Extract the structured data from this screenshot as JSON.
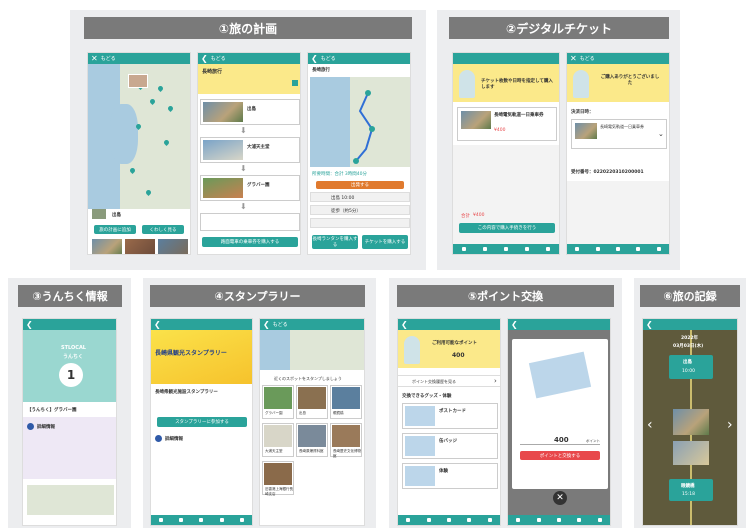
{
  "sections": {
    "s1": "①旅の計画",
    "s2": "②デジタルチケット",
    "s3": "③うんちく情報",
    "s4": "④スタンプラリー",
    "s5": "⑤ポイント交換",
    "s6": "⑥旅の記録"
  },
  "common": {
    "back_label": "もどる",
    "trip_title": "長崎旅行"
  },
  "plan": {
    "map_spot_name": "出島",
    "map_btn_add": "旅の計画に追加",
    "map_btn_detail": "くわしく見る",
    "list_spot1": "出島",
    "list_spot2": "大浦天主堂",
    "list_spot3": "グラバー園",
    "list_btn": "路面電車の乗車券を購入する",
    "route_time": "所要時間：合計 3時間40分",
    "route_btn": "出発する",
    "route_row1": "出島 10:00",
    "route_row2": "徒歩（約5分）",
    "route_btn_left": "長崎ランタンを購入する",
    "route_btn_right": "チケットを購入する"
  },
  "ticket": {
    "banner_left": "チケット枚数や日時を指定して購入します",
    "banner_right": "ご購入ありがとうございました",
    "ticket_name": "長崎電気軌道一日乗車券",
    "price": "¥400",
    "price_label": "合計",
    "buy_btn": "この内容で購入手続きを行う",
    "ticket_number_label": "決済日時：",
    "ticket_number": "受付番号：0220220310200001"
  },
  "trivia": {
    "app_brand": "STLOCAL",
    "title": "うんちく",
    "number": "1",
    "item_title": "【うんちく】グラバー園",
    "section_label": "詳細情報"
  },
  "stamp": {
    "banner_title": "長崎県観光スタンプラリー",
    "event_name": "長崎県観光施設スタンプラリー",
    "join_btn": "スタンプラリーに参加する",
    "section_label": "詳細情報",
    "list_header": "近くのスポットをスタンプしましょう",
    "spots": [
      "グラバー園",
      "出島",
      "眼鏡橋",
      "大浦天主堂",
      "長崎原爆資料館",
      "長崎歴史文化博物館",
      "旧香港上海銀行長崎支店"
    ]
  },
  "points": {
    "available_label": "ご利用可能なポイント",
    "available_value": "400",
    "exchange_label": "ポイント交換履歴を見る",
    "goods_label": "交換できるグッズ・体験",
    "card_number": "400",
    "card_unit": "ポイント",
    "card_btn": "ポイントと交換する",
    "goods": [
      "ポストカード",
      "缶バッジ",
      "体験"
    ]
  },
  "record": {
    "date_line1": "2022年",
    "date_line2": "03月03日(木)",
    "spot1": "出島",
    "spot2": "眼鏡橋",
    "time1": "10:00",
    "time2": "15:18"
  }
}
